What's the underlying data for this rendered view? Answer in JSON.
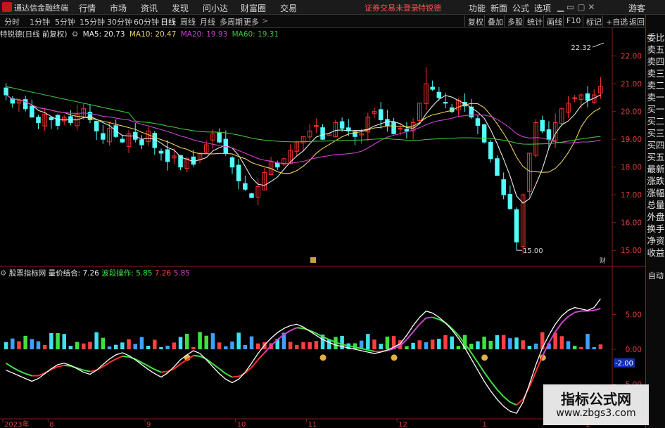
{
  "app": {
    "title": "通达信金融终端",
    "menu": [
      "行情",
      "市场",
      "资讯",
      "发现",
      "问小达",
      "财富圈",
      "交易"
    ],
    "notice": "证券交易未登录",
    "notice2": "特锐德",
    "right_menu": [
      "功能",
      "新面",
      "公式",
      "选项"
    ],
    "guest": "游客"
  },
  "periods": [
    "分时",
    "1分钟",
    "5分钟",
    "15分钟",
    "30分钟",
    "60分钟",
    "日线",
    "周线",
    "月线",
    "多周期",
    "更多"
  ],
  "active_period": "日线",
  "right_tools": [
    "复权",
    "叠加",
    "多股",
    "统计",
    "画线",
    "F10",
    "标记",
    "+自选",
    "返回"
  ],
  "main_panel": {
    "stock_label": "特锐德(日线 前复权)",
    "ma": [
      {
        "label": "MA5: 20.73",
        "color": "#e8e8e8"
      },
      {
        "label": "MA10: 20.47",
        "color": "#f0d060"
      },
      {
        "label": "MA20: 19.93",
        "color": "#d040d0"
      },
      {
        "label": "MA60: 19.31",
        "color": "#40c040"
      }
    ],
    "annot_high": "22.32",
    "annot_low": "15.00",
    "corner_btn": "财",
    "small_marker": "B"
  },
  "sub_panel": {
    "title": "股票指标网",
    "items": [
      {
        "label": "量价结合: 7.26",
        "color": "#e8e8e8"
      },
      {
        "label": "波段操作: 5.85",
        "color": "#40e040"
      },
      {
        "label": "7.26",
        "color": "#ff4040"
      },
      {
        "label": "5.85",
        "color": "#d040d0"
      }
    ],
    "current_label": "-2.00",
    "auto_label": "自动"
  },
  "side_panel": [
    "委比",
    "卖五",
    "卖四",
    "卖三",
    "卖二",
    "卖一",
    "买一",
    "买二",
    "买三",
    "买四",
    "买五",
    "最新",
    "涨跌",
    "涨幅",
    "总量",
    "外盘",
    "换手",
    "净资",
    "收益"
  ],
  "x_axis_labels": [
    {
      "label": "2023年",
      "idx": 0
    },
    {
      "label": "8",
      "idx": 7
    },
    {
      "label": "9",
      "idx": 22
    },
    {
      "label": "10",
      "idx": 36
    },
    {
      "label": "11",
      "idx": 47
    },
    {
      "label": "12",
      "idx": 61
    },
    {
      "label": "1",
      "idx": 74
    },
    {
      "label": "2",
      "idx": 90
    }
  ],
  "watermark": {
    "title": "指标公式网",
    "url": "www.zbgs3.com"
  },
  "chart_data": [
    {
      "type": "candlestick",
      "title": "特锐德(日线 前复权)",
      "y_ticks": [
        15.0,
        16.0,
        17.0,
        18.0,
        19.0,
        20.0,
        21.0,
        22.0
      ],
      "ylim": [
        14.6,
        22.6
      ],
      "grid": false,
      "candles_close": [
        20.6,
        20.3,
        20.4,
        20.1,
        19.8,
        19.6,
        19.9,
        19.7,
        19.5,
        19.8,
        19.6,
        19.9,
        20.1,
        19.7,
        19.3,
        19.0,
        19.4,
        19.1,
        18.9,
        19.2,
        19.0,
        18.8,
        19.3,
        18.7,
        18.5,
        18.2,
        18.4,
        18.0,
        18.3,
        18.1,
        18.5,
        18.8,
        19.2,
        18.9,
        18.5,
        18.0,
        17.5,
        17.2,
        16.9,
        17.3,
        17.8,
        18.2,
        18.0,
        18.3,
        18.6,
        18.9,
        19.1,
        19.3,
        19.5,
        19.0,
        19.2,
        19.6,
        19.4,
        19.3,
        19.1,
        19.2,
        19.8,
        20.0,
        19.7,
        19.5,
        19.2,
        19.4,
        19.3,
        19.6,
        20.3,
        21.0,
        20.8,
        20.5,
        20.3,
        20.0,
        20.4,
        20.2,
        19.8,
        19.5,
        18.9,
        18.3,
        17.7,
        17.0,
        16.5,
        15.3,
        17.0,
        18.5,
        19.6,
        19.3,
        19.0,
        19.6,
        20.1,
        20.3,
        20.5,
        20.6,
        20.4,
        20.6,
        20.9
      ],
      "series": [
        {
          "name": "MA5",
          "color": "#e8e8e8"
        },
        {
          "name": "MA10",
          "color": "#f0d060"
        },
        {
          "name": "MA20",
          "color": "#d040d0"
        },
        {
          "name": "MA60",
          "color": "#40c040"
        }
      ],
      "high_annotation": 22.32,
      "low_annotation": 15.0
    },
    {
      "type": "line",
      "title": "股票指标网",
      "y_ticks": [
        5.0,
        0.0,
        -5.0
      ],
      "ylim": [
        -10,
        10
      ],
      "series": [
        {
          "name": "量价结合",
          "color": "#ffffff",
          "values": [
            -3,
            -3.4,
            -3.8,
            -4.2,
            -4.6,
            -4.2,
            -3.5,
            -2.8,
            -2.2,
            -2.0,
            -2.3,
            -2.8,
            -3.3,
            -3.6,
            -3.0,
            -2.2,
            -1.4,
            -0.8,
            -0.5,
            -0.9,
            -1.5,
            -2.2,
            -2.9,
            -3.5,
            -4.0,
            -3.4,
            -2.5,
            -1.5,
            -0.8,
            -0.2,
            -0.6,
            -1.5,
            -2.5,
            -3.5,
            -4.3,
            -4.8,
            -4.3,
            -3.3,
            -2.0,
            -0.6,
            0.6,
            1.6,
            2.4,
            3.0,
            3.4,
            3.6,
            3.2,
            2.6,
            2.0,
            1.4,
            1.0,
            0.6,
            0.4,
            0.2,
            0.0,
            -0.2,
            -0.4,
            -0.6,
            -0.4,
            -0.1,
            0.3,
            0.8,
            2.0,
            3.4,
            4.6,
            5.5,
            5.2,
            4.6,
            3.8,
            2.8,
            1.6,
            0.2,
            -1.4,
            -3.0,
            -4.6,
            -6.0,
            -7.2,
            -8.2,
            -8.9,
            -9.2,
            -7.6,
            -5.0,
            -2.2,
            0.2,
            2.0,
            3.6,
            4.8,
            5.6,
            6.0,
            5.8,
            5.6,
            6.0,
            7.26
          ]
        },
        {
          "name": "波段操作",
          "color": "#40e040",
          "values": [
            -2.0,
            -2.6,
            -3.1,
            -3.5,
            -3.8,
            -3.8,
            -3.4,
            -2.9,
            -2.5,
            -2.3,
            -2.4,
            -2.7,
            -3.0,
            -3.2,
            -3.0,
            -2.5,
            -1.9,
            -1.4,
            -1.0,
            -1.1,
            -1.4,
            -1.9,
            -2.4,
            -2.9,
            -3.3,
            -3.2,
            -2.8,
            -2.1,
            -1.5,
            -0.9,
            -1.0,
            -1.4,
            -2.1,
            -2.8,
            -3.5,
            -4.0,
            -3.9,
            -3.4,
            -2.6,
            -1.5,
            -0.5,
            0.5,
            1.4,
            2.1,
            2.7,
            3.1,
            3.0,
            2.7,
            2.3,
            1.8,
            1.4,
            1.0,
            0.7,
            0.5,
            0.3,
            0.1,
            -0.1,
            -0.3,
            -0.3,
            -0.2,
            0.1,
            0.5,
            1.4,
            2.5,
            3.6,
            4.5,
            4.6,
            4.3,
            3.8,
            3.0,
            2.0,
            0.8,
            -0.5,
            -1.9,
            -3.3,
            -4.6,
            -5.8,
            -6.8,
            -7.6,
            -8.0,
            -7.2,
            -5.4,
            -3.2,
            -1.0,
            0.9,
            2.5,
            3.8,
            4.7,
            5.3,
            5.5,
            5.5,
            5.6,
            5.85
          ]
        }
      ],
      "bars_note": "red/cyan volume-price histogram around 0"
    }
  ]
}
